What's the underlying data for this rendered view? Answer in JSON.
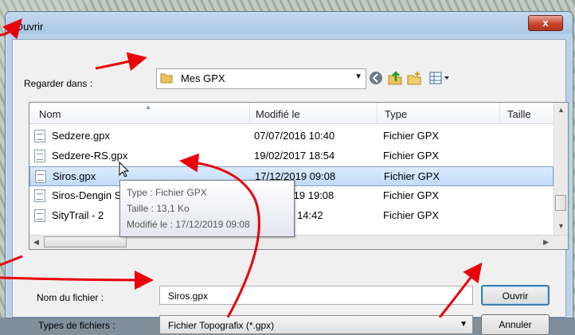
{
  "dialog": {
    "title": "Ouvrir",
    "close_label": "x"
  },
  "look_in": {
    "label": "Regarder dans :",
    "value": "Mes GPX"
  },
  "toolbar": {
    "icons": [
      "back-icon",
      "up-folder-icon",
      "new-folder-icon",
      "view-menu-icon"
    ]
  },
  "list": {
    "columns": [
      "Nom",
      "Modifié le",
      "Type",
      "Taille"
    ],
    "rows": [
      {
        "name": "Sedzere.gpx",
        "modified": "07/07/2016 10:40",
        "type": "Fichier GPX"
      },
      {
        "name": "Sedzere-RS.gpx",
        "modified": "19/02/2017 18:54",
        "type": "Fichier GPX"
      },
      {
        "name": "Siros.gpx",
        "modified": "17/12/2019 09:08",
        "type": "Fichier GPX",
        "selected": true
      },
      {
        "name": "Siros-Dengin Saligue.gpx",
        "modified": "11/06/2019 19:08",
        "type": "Fichier GPX"
      },
      {
        "name": "SityTrail - 2",
        "modified": "19 14:42",
        "type": "Fichier GPX"
      }
    ]
  },
  "tooltip": {
    "type_line": "Type : Fichier GPX",
    "size_line": "Taille : 13,1 Ko",
    "modified_line": "Modifié le : 17/12/2019 09:08"
  },
  "filename": {
    "label": "Nom du fichier :",
    "value": "Siros.gpx"
  },
  "filetype": {
    "label": "Types de fichiers :",
    "value": "Fichier Topografix (*.gpx)"
  },
  "buttons": {
    "open": "Ouvrir",
    "cancel": "Annuler"
  },
  "annotation_color": "#e8000b"
}
